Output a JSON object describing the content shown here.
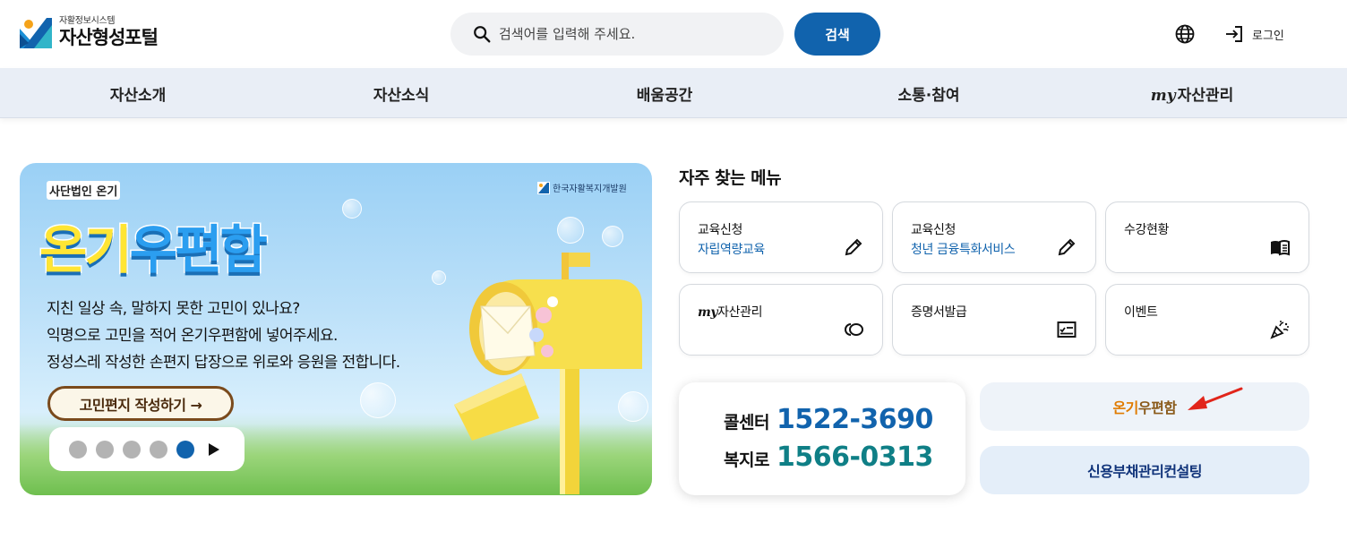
{
  "header": {
    "logo_sub": "자활정보시스템",
    "logo_main": "자산형성포털",
    "search_placeholder": "검색어를 입력해 주세요.",
    "search_button": "검색",
    "login_label": "로그인"
  },
  "nav": {
    "items": [
      "자산소개",
      "자산소식",
      "배움공간",
      "소통·참여"
    ],
    "my_prefix": "my",
    "my_label": "자산관리"
  },
  "banner": {
    "org": "사단법인 온기",
    "institute": "한국자활복지개발원",
    "title_a": "온기",
    "title_b": "우편함",
    "lines": [
      "지친 일상 속, 말하지 못한 고민이 있나요?",
      "익명으로 고민을 적어 온기우편함에 넣어주세요.",
      "정성스레 작성한 손편지 답장으로 위로와 응원을 전합니다."
    ],
    "cta": "고민편지 작성하기 →",
    "slide_active": 5,
    "slide_count": 5
  },
  "quick_menu": {
    "title": "자주 찾는 메뉴",
    "cards": [
      {
        "line1": "교육신청",
        "line2": "자립역량교육",
        "icon": "pencil-icon"
      },
      {
        "line1": "교육신청",
        "line2": "청년 금융특화서비스",
        "icon": "pencil-icon"
      },
      {
        "line1": "수강현황",
        "line2": "",
        "icon": "book-icon"
      },
      {
        "line1_prefix": "my",
        "line1": "자산관리",
        "line2": "",
        "icon": "coins-icon"
      },
      {
        "line1": "증명서발급",
        "line2": "",
        "icon": "certificate-icon"
      },
      {
        "line1": "이벤트",
        "line2": "",
        "icon": "party-popper-icon"
      }
    ]
  },
  "contact": {
    "call_label": "콜센터",
    "call_number": "1522-3690",
    "welfare_label": "복지로",
    "welfare_number": "1566-0313"
  },
  "links": {
    "ongi_a": "온기",
    "ongi_b": "우편함",
    "credit": "신용부채관리컨설팅"
  },
  "colors": {
    "primary": "#1163ad",
    "teal": "#0f7f86",
    "nav_bg": "#e9eef6",
    "ongi_orange": "#e07b00",
    "ongi_brown": "#8a5a1a",
    "arrow_red": "#e1251b"
  }
}
